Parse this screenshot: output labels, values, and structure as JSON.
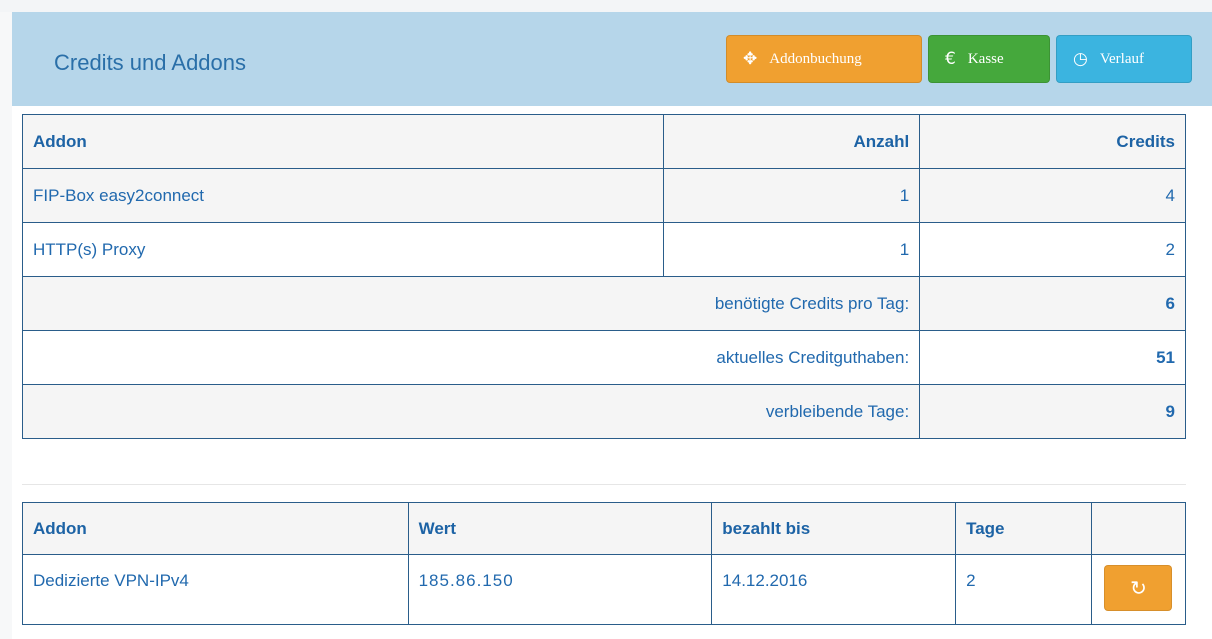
{
  "header": {
    "title": "Credits und Addons",
    "buttons": {
      "addonbuchung": "Addonbuchung",
      "kasse": "Kasse",
      "verlauf": "Verlauf"
    },
    "icons": {
      "addonbuchung": "move-icon",
      "kasse": "euro-icon",
      "verlauf": "clock-icon"
    }
  },
  "credits_table": {
    "headers": [
      "Addon",
      "Anzahl",
      "Credits"
    ],
    "rows": [
      {
        "addon": "FIP-Box easy2connect",
        "anzahl": "1",
        "credits": "4"
      },
      {
        "addon": "HTTP(s) Proxy",
        "anzahl": "1",
        "credits": "2"
      }
    ],
    "summary": [
      {
        "label": "benötigte Credits pro Tag:",
        "value": "6"
      },
      {
        "label": "aktuelles Creditguthaben:",
        "value": "51"
      },
      {
        "label": "verbleibende Tage:",
        "value": "9"
      }
    ]
  },
  "addon_table": {
    "headers": [
      "Addon",
      "Wert",
      "bezahlt bis",
      "Tage",
      ""
    ],
    "rows": [
      {
        "addon": "Dedizierte VPN-IPv4",
        "wert": "185.86.150",
        "bezahlt_bis": "14.12.2016",
        "tage": "2"
      }
    ]
  },
  "colors": {
    "header_bg": "#b6d6ea",
    "orange": "#f0a030",
    "green": "#45a83c",
    "blue": "#3bb4e0",
    "text": "#2169ae"
  }
}
